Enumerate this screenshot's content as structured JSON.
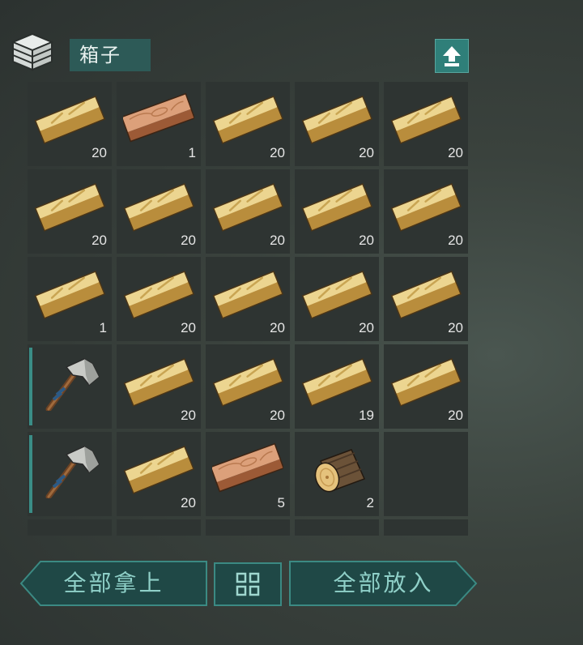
{
  "container": {
    "title": "箱子",
    "icon": "box-icon",
    "sort_icon": "upload-arrow-icon"
  },
  "slots": [
    {
      "item": "wood-plank",
      "qty": "20"
    },
    {
      "item": "oak-plank",
      "qty": "1"
    },
    {
      "item": "wood-plank",
      "qty": "20"
    },
    {
      "item": "wood-plank",
      "qty": "20"
    },
    {
      "item": "wood-plank",
      "qty": "20"
    },
    {
      "item": "wood-plank",
      "qty": "20"
    },
    {
      "item": "wood-plank",
      "qty": "20"
    },
    {
      "item": "wood-plank",
      "qty": "20"
    },
    {
      "item": "wood-plank",
      "qty": "20"
    },
    {
      "item": "wood-plank",
      "qty": "20"
    },
    {
      "item": "wood-plank",
      "qty": "1"
    },
    {
      "item": "wood-plank",
      "qty": "20"
    },
    {
      "item": "wood-plank",
      "qty": "20"
    },
    {
      "item": "wood-plank",
      "qty": "20"
    },
    {
      "item": "wood-plank",
      "qty": "20"
    },
    {
      "item": "stone-hatchet",
      "qty": ""
    },
    {
      "item": "wood-plank",
      "qty": "20"
    },
    {
      "item": "wood-plank",
      "qty": "20"
    },
    {
      "item": "wood-plank",
      "qty": "19"
    },
    {
      "item": "wood-plank",
      "qty": "20"
    },
    {
      "item": "stone-hatchet",
      "qty": ""
    },
    {
      "item": "wood-plank",
      "qty": "20"
    },
    {
      "item": "oak-plank",
      "qty": "5"
    },
    {
      "item": "log",
      "qty": "2"
    },
    {
      "item": "",
      "qty": ""
    },
    {
      "item": "",
      "qty": ""
    },
    {
      "item": "",
      "qty": ""
    },
    {
      "item": "",
      "qty": ""
    },
    {
      "item": "",
      "qty": ""
    },
    {
      "item": "",
      "qty": ""
    }
  ],
  "buttons": {
    "take_all": "全部拿上",
    "put_all": "全部放入",
    "grid_icon": "grid-view-icon"
  },
  "colors": {
    "accent": "#2f7f79",
    "slot_bg": "#2e3432",
    "tool_marker": "#3a8d86"
  }
}
